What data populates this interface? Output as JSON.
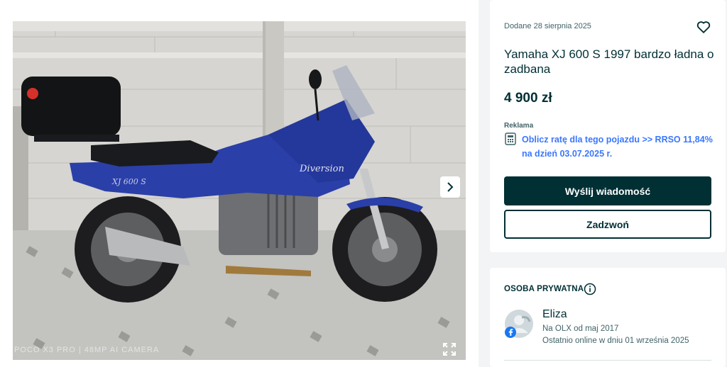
{
  "gallery": {
    "watermark": "POCO X3 PRO | 48MP AI CAMERA",
    "photo_colors": {
      "bike_blue": "#2a3fa8",
      "wall": "#d4d3cf",
      "paving": "#c8c8c5"
    }
  },
  "listing": {
    "added_date": "Dodane 28 sierpnia 2025",
    "title": "Yamaha XJ 600 S 1997 bardzo ładna o zadbana",
    "price": "4 900 zł",
    "ad_label": "Reklama",
    "promo_link": "Oblicz ratę dla tego pojazdu >> RRSO 11,84% na dzień 03.07.2025 r.",
    "message_button": "Wyślij wiadomość",
    "call_button": "Zadzwoń"
  },
  "seller": {
    "type_label": "OSOBA PRYWATNA",
    "name": "Eliza",
    "member_since": "Na OLX od maj 2017",
    "last_online": "Ostatnio online w dniu 01 września 2025"
  },
  "colors": {
    "primary_dark": "#002f34",
    "link_blue": "#3a77ff",
    "muted": "#406367",
    "background": "#f2f4f5"
  },
  "icons": [
    "heart-icon",
    "calculator-icon",
    "chevron-right-icon",
    "expand-icon",
    "info-icon",
    "facebook-icon"
  ]
}
